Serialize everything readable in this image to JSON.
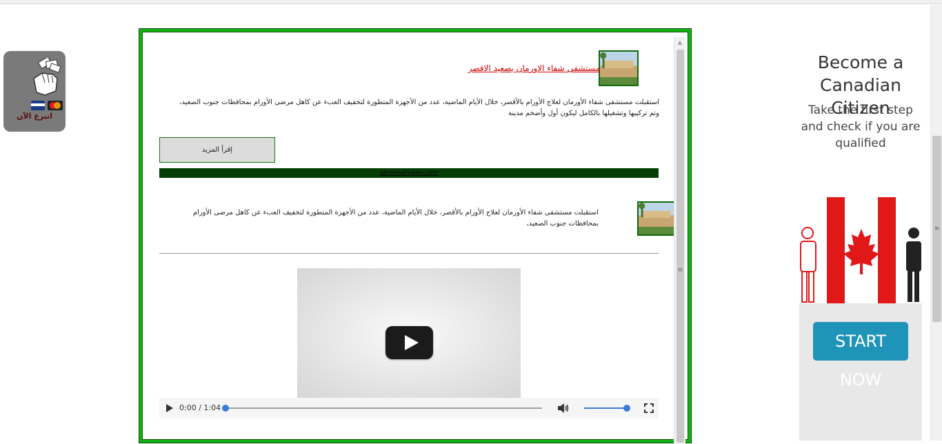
{
  "donate": {
    "label": "انبرع الآن",
    "hand_icon": "hand-holding-money-icon",
    "cards_icon": "payment-cards-icon"
  },
  "article1": {
    "title": "مستشفى شفاء الاورمان بصعيد الاقصر",
    "text": "استقبلت مستشفى شفاء الأورمان لعلاج الأورام بالأقصر، خلال الأيام الماضية، عدد من الأجهزة المتطورة لتخفيف العبء عن كاهل مرضى الأورام بمحافظات جنوب الصعيد، وتم تركيبها وتشغيلها بالكامل ليكون أول وأضخم مدينة",
    "read_more_label": "إقرأ المزيد"
  },
  "green_bar": {
    "link_text": "ahramalmaan.com"
  },
  "article2": {
    "text": "استقبلت مستشفى شفاء الأورمان لعلاج الأورام بالأقصر، خلال الأيام الماضية، عدد من الأجهزة المتطورة لتخفيف العبء عن كاهل مرضى الأورام بمحافظات جنوب الصعيد،"
  },
  "video": {
    "time_display": "0:00 / 1:04",
    "progress": 0,
    "volume": 1.0
  },
  "ad": {
    "headline": "Become a Canadian Citizen",
    "body": "Take the first step and check if you are qualified",
    "button_label": "START NOW"
  },
  "colors": {
    "frame_border": "#13b113",
    "green_bar": "#053d05",
    "title_link": "#d10000",
    "ad_button": "#1f93b8"
  }
}
